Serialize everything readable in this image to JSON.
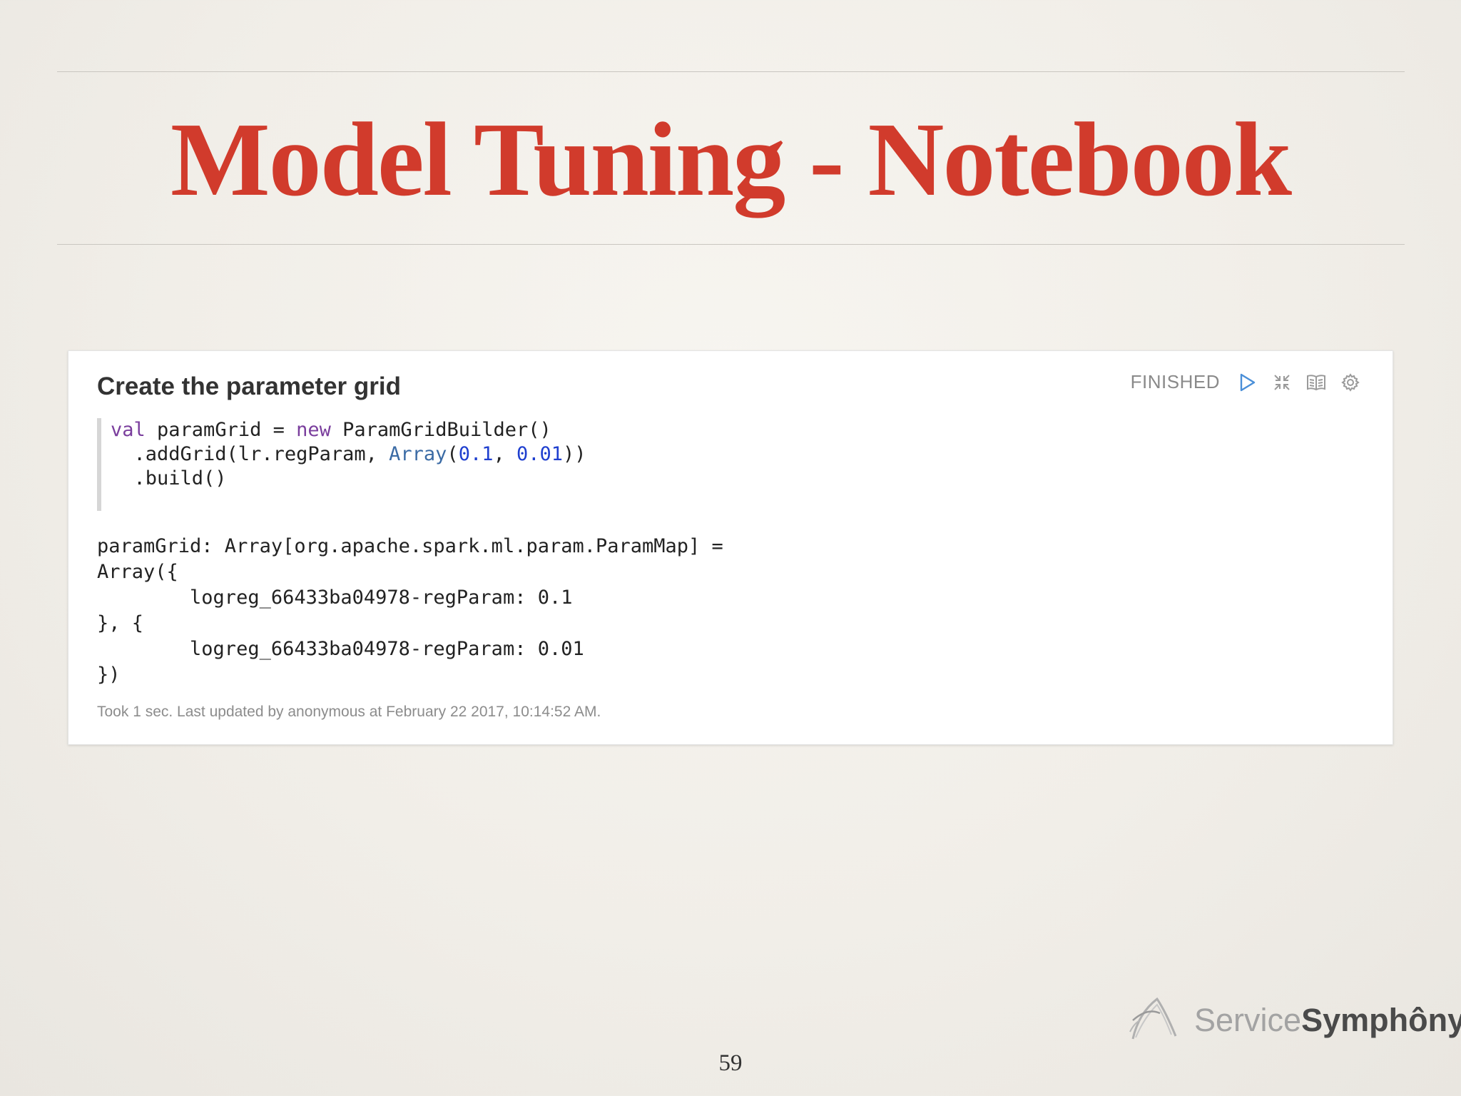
{
  "slide": {
    "title": "Model Tuning - Notebook",
    "page_number": "59"
  },
  "paragraph": {
    "title": "Create the parameter grid",
    "status": "FINISHED",
    "icons": [
      "run-icon",
      "collapse-icon",
      "book-icon",
      "gear-icon"
    ],
    "code": {
      "line1": {
        "kw_val": "val",
        "text1": " paramGrid = ",
        "kw_new": "new",
        "text2": " ParamGridBuilder()"
      },
      "line2": {
        "text1": "  .addGrid(lr.regParam, ",
        "type": "Array",
        "text2": "(",
        "num1": "0.1",
        "text3": ", ",
        "num2": "0.01",
        "text4": "))"
      },
      "line3": {
        "text": "  .build()"
      }
    },
    "output_lines": [
      "paramGrid: Array[org.apache.spark.ml.param.ParamMap] =",
      "Array({",
      "        logreg_66433ba04978-regParam: 0.1",
      "}, {",
      "        logreg_66433ba04978-regParam: 0.01",
      "})"
    ],
    "footer": "Took 1 sec. Last updated by anonymous at February 22 2017, 10:14:52 AM."
  },
  "brand": {
    "light": "Service",
    "bold": "Symphôny"
  },
  "colors": {
    "title": "#d13b2c",
    "status": "#8a8a8a",
    "run_icon": "#4a8fd8",
    "keyword": "#7a3e9d",
    "number": "#1f3fcf"
  }
}
